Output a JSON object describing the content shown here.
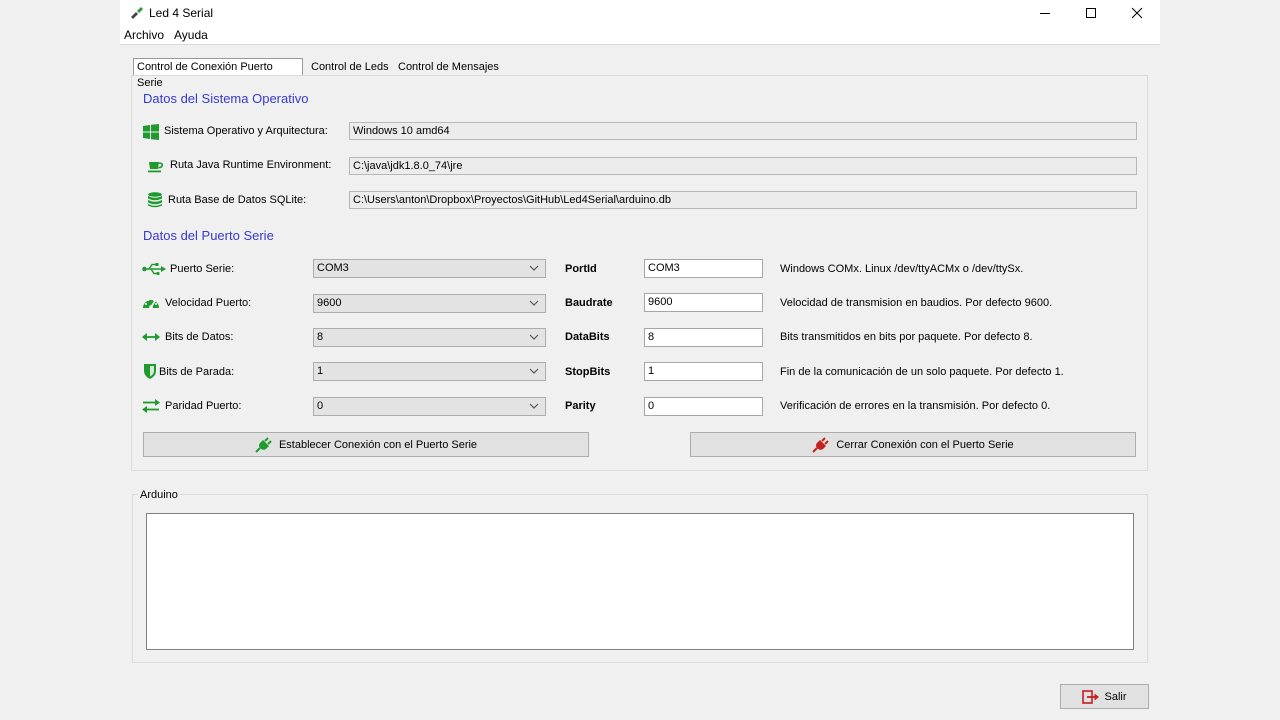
{
  "window": {
    "title": "Led 4 Serial",
    "minimize_icon": "minimize-icon",
    "maximize_icon": "maximize-icon",
    "close_icon": "close-icon"
  },
  "menu": [
    "Archivo",
    "Ayuda"
  ],
  "tabs": [
    {
      "label": "Control de Conexión Puerto Serie",
      "active": true
    },
    {
      "label": "Control de Leds",
      "active": false
    },
    {
      "label": "Control de Mensajes",
      "active": false
    }
  ],
  "os_section": {
    "title": "Datos del Sistema Operativo",
    "rows": [
      {
        "icon": "windows-logo-icon",
        "label": "Sistema Operativo y Arquitectura:",
        "value": "Windows 10 amd64"
      },
      {
        "icon": "java-cup-icon",
        "label": "Ruta Java Runtime Environment:",
        "value": "C:\\java\\jdk1.8.0_74\\jre"
      },
      {
        "icon": "database-icon",
        "label": "Ruta Base de Datos SQLite:",
        "value": "C:\\Users\\anton\\Dropbox\\Proyectos\\GitHub\\Led4Serial\\arduino.db"
      }
    ]
  },
  "port_section": {
    "title": "Datos del Puerto Serie",
    "rows": [
      {
        "icon": "usb-icon",
        "label": "Puerto Serie:",
        "combo": "COM3",
        "param": "PortId",
        "input": "COM3",
        "desc": "Windows COMx. Linux /dev/ttyACMx o /dev/ttySx."
      },
      {
        "icon": "speedometer-icon",
        "label": "Velocidad Puerto:",
        "combo": "9600",
        "param": "Baudrate",
        "input": "9600",
        "desc": "Velocidad de transmision en baudios. Por defecto 9600."
      },
      {
        "icon": "horizontal-arrows-icon",
        "label": "Bits de Datos:",
        "combo": "8",
        "param": "DataBits",
        "input": "8",
        "desc": "Bits transmitidos en bits por paquete. Por defecto 8."
      },
      {
        "icon": "shield-icon",
        "label": "Bits de Parada:",
        "combo": "1",
        "param": "StopBits",
        "input": "1",
        "desc": "Fin de la comunicación de un solo paquete. Por defecto 1."
      },
      {
        "icon": "swap-arrows-icon",
        "label": "Paridad Puerto:",
        "combo": "0",
        "param": "Parity",
        "input": "0",
        "desc": "Verificación de errores en la transmisión. Por defecto 0."
      }
    ]
  },
  "buttons": {
    "connect": "Establecer Conexión con el Puerto Serie",
    "disconnect": "Cerrar Conexión con el Puerto Serie",
    "exit": "Salir"
  },
  "arduino_group": {
    "title": "Arduino",
    "content": ""
  },
  "colors": {
    "section_title": "#3838d0",
    "icon_green": "#1e9a2e",
    "icon_red": "#c42020"
  }
}
